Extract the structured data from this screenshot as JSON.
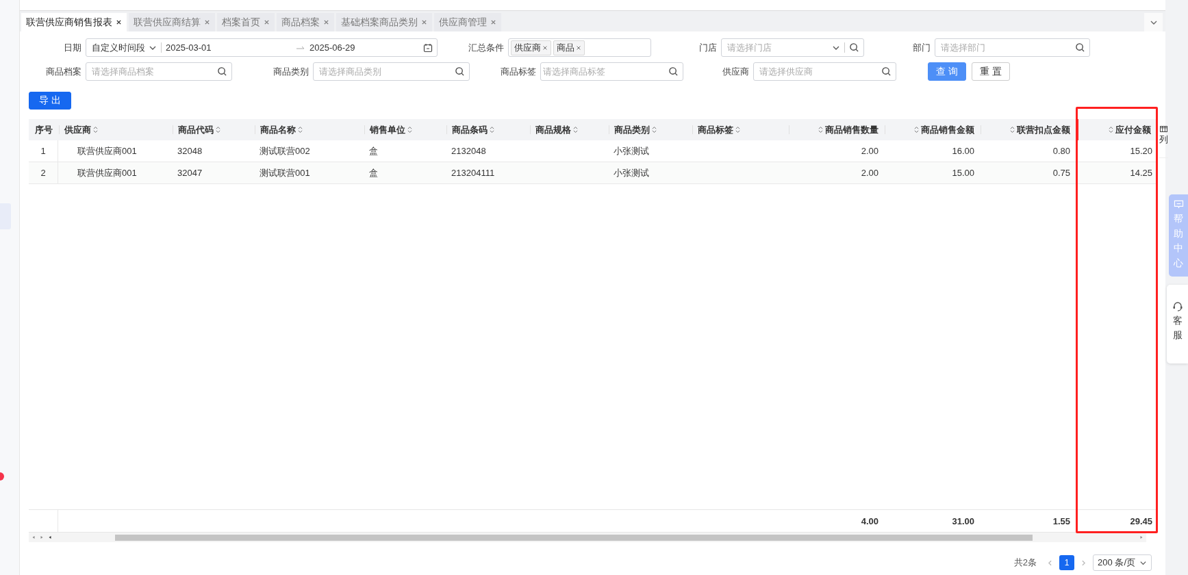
{
  "tabs": [
    {
      "label": "联营供应商销售报表",
      "selected": true
    },
    {
      "label": "联营供应商结算",
      "selected": false
    },
    {
      "label": "档案首页",
      "selected": false
    },
    {
      "label": "商品档案",
      "selected": false
    },
    {
      "label": "基础档案商品类别",
      "selected": false
    },
    {
      "label": "供应商管理",
      "selected": false
    }
  ],
  "filters": {
    "date": {
      "label": "日期",
      "mode": "自定义时间段",
      "start": "2025-03-01",
      "end": "2025-06-29"
    },
    "summary": {
      "label": "汇总条件",
      "tags": [
        "供应商",
        "商品"
      ]
    },
    "store": {
      "label": "门店",
      "placeholder": "请选择门店"
    },
    "department": {
      "label": "部门",
      "placeholder": "请选择部门"
    },
    "product": {
      "label": "商品档案",
      "placeholder": "请选择商品档案"
    },
    "category": {
      "label": "商品类别",
      "placeholder": "请选择商品类别"
    },
    "tag": {
      "label": "商品标签",
      "placeholder": "请选择商品标签"
    },
    "supplier": {
      "label": "供应商",
      "placeholder": "请选择供应商"
    }
  },
  "buttons": {
    "query": "查 询",
    "reset": "重 置",
    "export": "导 出"
  },
  "table": {
    "columns": [
      {
        "label": "序号",
        "kind": "index",
        "sortable": false,
        "highlighted": false
      },
      {
        "label": "供应商",
        "kind": "text",
        "sortable": true,
        "highlighted": false
      },
      {
        "label": "商品代码",
        "kind": "text",
        "sortable": true,
        "highlighted": false
      },
      {
        "label": "商品名称",
        "kind": "text",
        "sortable": true,
        "highlighted": false
      },
      {
        "label": "销售单位",
        "kind": "text",
        "sortable": true,
        "highlighted": false
      },
      {
        "label": "商品条码",
        "kind": "text",
        "sortable": true,
        "highlighted": false
      },
      {
        "label": "商品规格",
        "kind": "text",
        "sortable": true,
        "highlighted": false
      },
      {
        "label": "商品类别",
        "kind": "text",
        "sortable": true,
        "highlighted": false
      },
      {
        "label": "商品标签",
        "kind": "text",
        "sortable": true,
        "highlighted": false
      },
      {
        "label": "商品销售数量",
        "kind": "number",
        "sortable": true,
        "highlighted": false,
        "total": "4.00"
      },
      {
        "label": "商品销售金额",
        "kind": "number",
        "sortable": true,
        "highlighted": false,
        "total": "31.00"
      },
      {
        "label": "联营扣点金额",
        "kind": "number",
        "sortable": true,
        "highlighted": false,
        "total": "1.55"
      },
      {
        "label": "应付金额",
        "kind": "number",
        "sortable": true,
        "highlighted": true,
        "total": "29.45"
      }
    ],
    "rows": [
      [
        "1",
        "联营供应商001",
        "32048",
        "测试联营002",
        "盒",
        "2132048",
        "",
        "小张测试",
        "",
        "2.00",
        "16.00",
        "0.80",
        "15.20"
      ],
      [
        "2",
        "联营供应商001",
        "32047",
        "测试联营001",
        "盒",
        "213204111",
        "",
        "小张测试",
        "",
        "2.00",
        "15.00",
        "0.75",
        "14.25"
      ]
    ],
    "column_settings": "列"
  },
  "pagination": {
    "total": "共2条",
    "pages": [
      {
        "label": "1",
        "selected": true
      }
    ],
    "page_size": "200 条/页"
  },
  "side": {
    "help": "帮助中心",
    "service": "客服"
  }
}
